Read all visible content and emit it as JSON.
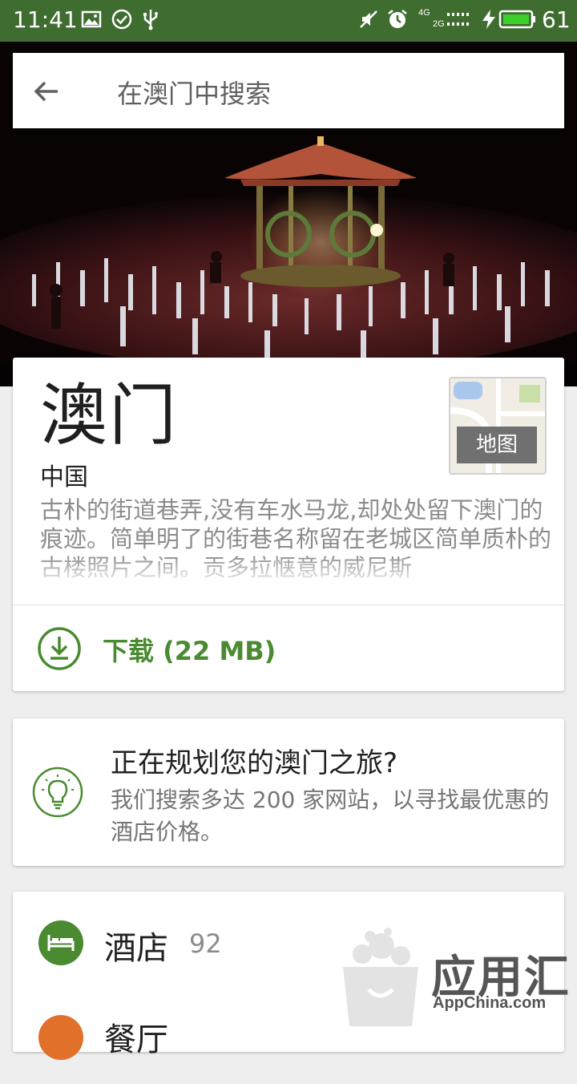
{
  "status_bar": {
    "time": "11:41",
    "network_4g": "4G",
    "network_2g": "2G",
    "battery": "61",
    "left_icons": [
      "image-icon",
      "check-circle-icon",
      "usb-icon"
    ],
    "right_icons": [
      "mute-icon",
      "alarm-icon",
      "signal-icon",
      "charging-icon",
      "battery-icon"
    ]
  },
  "search": {
    "placeholder": "在澳门中搜索"
  },
  "place": {
    "title": "澳门",
    "country": "中国",
    "description": "古朴的街道巷弄,没有车水马龙,却处处留下澳门的痕迹。简单明了的街巷名称留在老城区简单质朴的古楼照片之间。贡多拉惬意的威尼斯",
    "map_label": "地图",
    "download_label": "下载 (22 MB)"
  },
  "planning": {
    "title": "正在规划您的澳门之旅?",
    "description": "我们搜索多达 200 家网站，以寻找最优惠的酒店价格。"
  },
  "categories": [
    {
      "label": "酒店",
      "count": "92",
      "color": "#4a8a30",
      "icon": "bed-icon"
    },
    {
      "label": "餐厅",
      "count": "",
      "color": "#e0702a",
      "icon": "restaurant-icon"
    }
  ],
  "watermark": {
    "brand": "应用汇",
    "site": "AppChina.com"
  },
  "colors": {
    "status_bar": "#3f6c2f",
    "accent_green": "#4a8a30",
    "orange": "#e0702a"
  }
}
